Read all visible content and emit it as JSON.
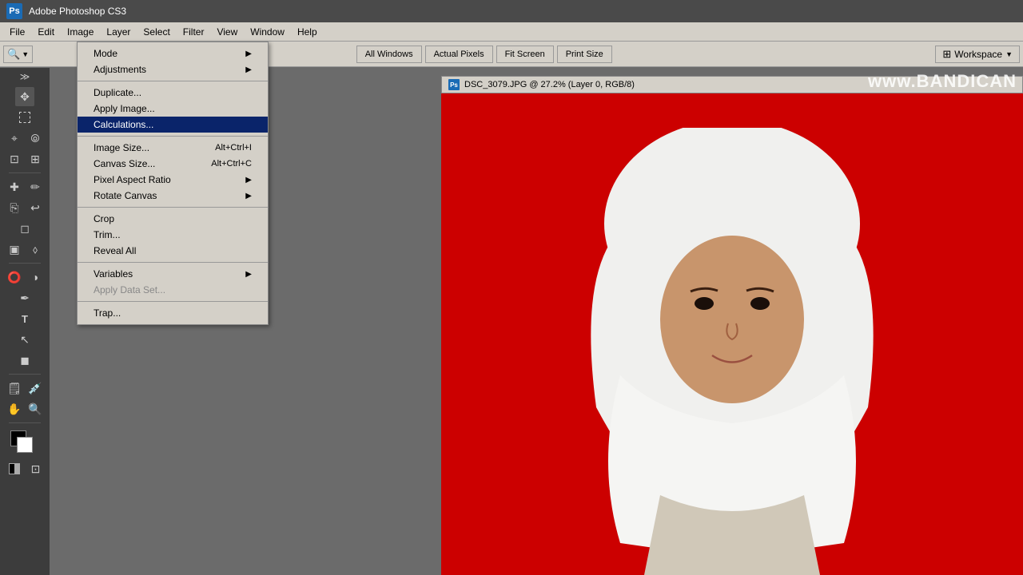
{
  "app": {
    "title": "Adobe Photoshop CS3",
    "logo": "Ps"
  },
  "menubar": {
    "items": [
      "File",
      "Edit",
      "Image",
      "Layer",
      "Select",
      "Filter",
      "View",
      "Window",
      "Help"
    ]
  },
  "toolbar": {
    "buttons": [
      "All Windows",
      "Actual Pixels",
      "Fit Screen",
      "Print Size"
    ]
  },
  "workspace": {
    "label": "Workspace",
    "icon": "▼"
  },
  "image_menu": {
    "sections": [
      {
        "items": [
          {
            "label": "Mode",
            "arrow": "▶",
            "shortcut": ""
          },
          {
            "label": "Adjustments",
            "arrow": "▶",
            "shortcut": ""
          }
        ]
      },
      {
        "items": [
          {
            "label": "Duplicate...",
            "arrow": "",
            "shortcut": ""
          },
          {
            "label": "Apply Image...",
            "arrow": "",
            "shortcut": ""
          },
          {
            "label": "Calculations...",
            "arrow": "",
            "shortcut": "",
            "highlighted": true
          }
        ]
      },
      {
        "items": [
          {
            "label": "Image Size...",
            "arrow": "",
            "shortcut": "Alt+Ctrl+I"
          },
          {
            "label": "Canvas Size...",
            "arrow": "",
            "shortcut": "Alt+Ctrl+C"
          },
          {
            "label": "Pixel Aspect Ratio",
            "arrow": "▶",
            "shortcut": ""
          },
          {
            "label": "Rotate Canvas",
            "arrow": "▶",
            "shortcut": ""
          }
        ]
      },
      {
        "items": [
          {
            "label": "Crop",
            "arrow": "",
            "shortcut": ""
          },
          {
            "label": "Trim...",
            "arrow": "",
            "shortcut": ""
          },
          {
            "label": "Reveal All",
            "arrow": "",
            "shortcut": ""
          }
        ]
      },
      {
        "items": [
          {
            "label": "Variables",
            "arrow": "▶",
            "shortcut": ""
          },
          {
            "label": "Apply Data Set...",
            "arrow": "",
            "shortcut": "",
            "disabled": true
          }
        ]
      },
      {
        "items": [
          {
            "label": "Trap...",
            "arrow": "",
            "shortcut": ""
          }
        ]
      }
    ]
  },
  "document": {
    "title": "DSC_3079.JPG @ 27.2% (Layer 0, RGB/8)"
  },
  "watermark": "www.BANDICAN"
}
